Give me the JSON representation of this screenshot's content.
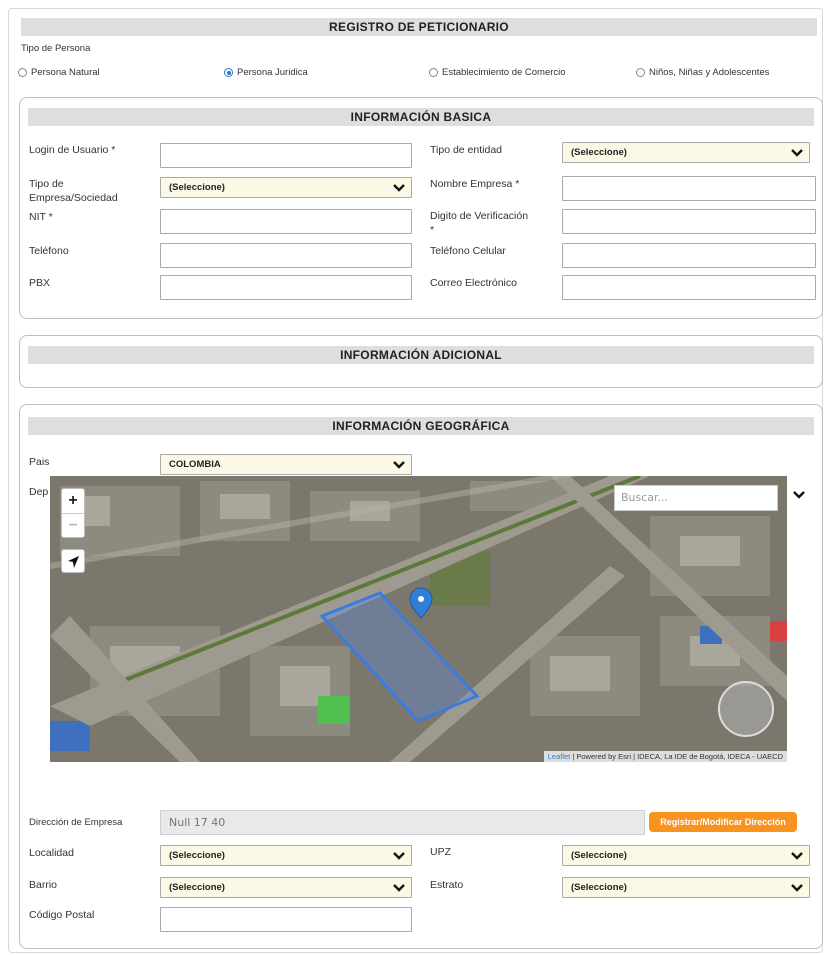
{
  "header": {
    "title": "REGISTRO DE PETICIONARIO"
  },
  "persona": {
    "label": "Tipo de Persona",
    "options": [
      "Persona Natural",
      "Persona Juridica",
      "Establecimiento de Comercio",
      "Niños, Niñas y Adolescentes"
    ],
    "selected": "Persona Juridica"
  },
  "basica": {
    "title": "INFORMACIÓN BASICA",
    "login_label": "Login de Usuario *",
    "tipo_entidad_label": "Tipo de entidad",
    "tipo_entidad_value": "(Seleccione)",
    "tipo_empresa_label_1": "Tipo de",
    "tipo_empresa_label_2": "Empresa/Sociedad",
    "tipo_empresa_value": "(Seleccione)",
    "nombre_empresa_label": "Nombre Empresa *",
    "nit_label": "NIT *",
    "digito_label_1": "Digito de Verificación",
    "digito_label_2": "*",
    "telefono_label": "Teléfono",
    "celular_label": "Teléfono Celular",
    "pbx_label": "PBX",
    "correo_label": "Correo Electrónico"
  },
  "adicional": {
    "title": "INFORMACIÓN ADICIONAL"
  },
  "geografica": {
    "title": "INFORMACIÓN GEOGRÁFICA",
    "pais_label": "Pais",
    "pais_value": "COLOMBIA",
    "depto_label": "Dep",
    "map": {
      "zoom_in": "+",
      "zoom_out": "−",
      "search_placeholder": "Buscar...",
      "attribution_leaflet": "Leaflet",
      "attribution_rest": " | Powered by Esri | IDECA, La IDE de Bogotá, IDECA - UAECD"
    },
    "direccion_label": "Dirección de Empresa",
    "direccion_value": "Null 17 40",
    "direccion_button": "Registrar/Modificar Dirección",
    "localidad_label": "Localidad",
    "localidad_value": "(Seleccione)",
    "upz_label": "UPZ",
    "upz_value": "(Seleccione)",
    "barrio_label": "Barrio",
    "barrio_value": "(Seleccione)",
    "estrato_label": "Estrato",
    "estrato_value": "(Seleccione)",
    "postal_label": "Código Postal"
  },
  "colors": {
    "accent": "#2a7cd6",
    "orange": "#f7931e",
    "select_bg": "#fbf8e6",
    "bar_bg": "#dedede"
  }
}
